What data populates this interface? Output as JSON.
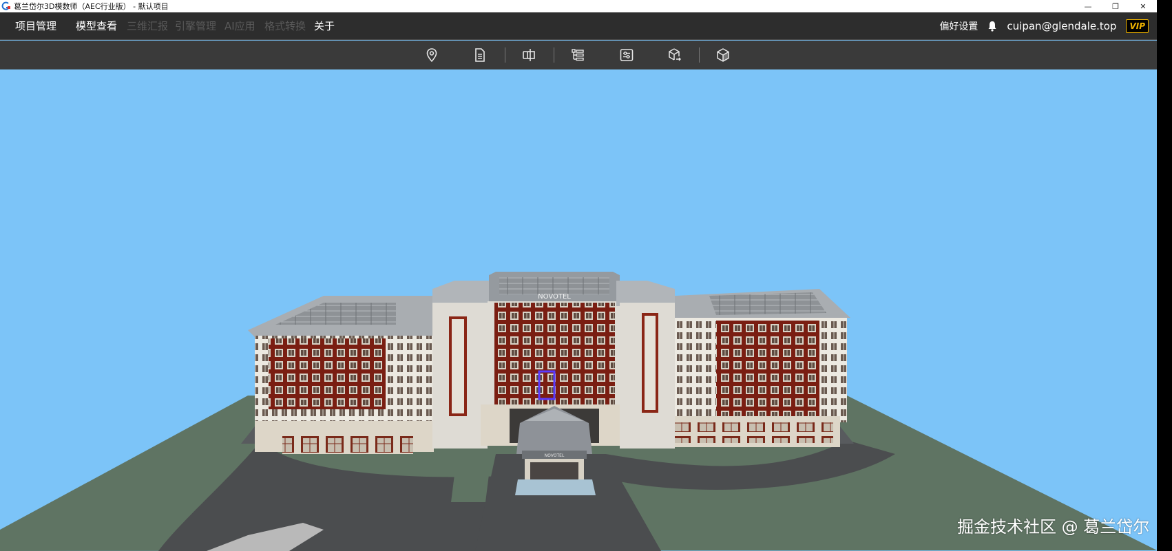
{
  "window": {
    "title": "葛兰岱尔3D模数师（AEC行业版） - 默认项目",
    "controls": [
      "—",
      "❐",
      "✕"
    ]
  },
  "menubar": {
    "items": [
      {
        "label": "项目管理",
        "enabled": true
      },
      {
        "label": "模型查看",
        "enabled": true
      },
      {
        "label": "三维汇报",
        "enabled": false
      },
      {
        "label": "引擎管理",
        "enabled": false
      },
      {
        "label": "AI应用",
        "enabled": false
      },
      {
        "label": "格式转换",
        "enabled": false
      },
      {
        "label": "关于",
        "enabled": true
      }
    ],
    "preferences_label": "偏好设置",
    "user_email": "cuipan@glendale.top",
    "vip_badge": "VIP"
  },
  "toolbar": {
    "tools": [
      {
        "icon": "location-pin-icon"
      },
      {
        "icon": "document-icon"
      },
      {
        "icon": "section-icon"
      },
      {
        "icon": "tree-icon"
      },
      {
        "icon": "settings-panel-icon"
      },
      {
        "icon": "cube-export-icon"
      },
      {
        "icon": "cube-icon"
      }
    ]
  },
  "scene": {
    "sign_main": "NOVOTEL",
    "sign_entrance": "NOVOTEL"
  },
  "watermark": "掘金技术社区 @ 葛兰岱尔",
  "colors": {
    "sky": "#7cc4f8",
    "ground": "#5f7463",
    "road": "#4b4d4f",
    "menubar": "#2d2d2d",
    "toolbar": "#3a3a3a",
    "vip": "#f0b400"
  }
}
